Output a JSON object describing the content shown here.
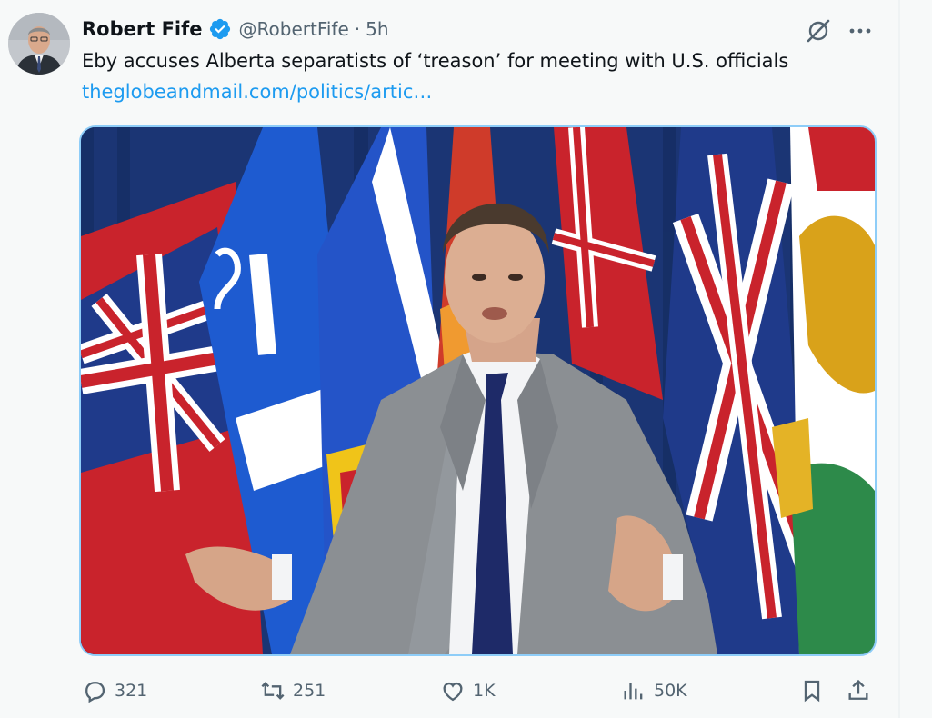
{
  "tweet": {
    "author_name": "Robert Fife",
    "handle": "@RobertFife",
    "separator": "·",
    "time": "5h",
    "text": "Eby accuses Alberta separatists of ‘treason’ for meeting with U.S. officials",
    "link": "theglobeandmail.com/politics/artic…"
  },
  "icons": {
    "verified": "verified-badge-icon",
    "grok": "grok-icon",
    "more": "more-icon",
    "reply": "reply-icon",
    "retweet": "retweet-icon",
    "like": "like-icon",
    "views": "views-icon",
    "bookmark": "bookmark-icon",
    "share": "share-icon"
  },
  "actions": {
    "replies": "321",
    "retweets": "251",
    "likes": "1K",
    "views": "50K"
  },
  "colors": {
    "accent": "#1d9bf0",
    "muted": "#536471",
    "media_border": "#8ecdf8"
  }
}
